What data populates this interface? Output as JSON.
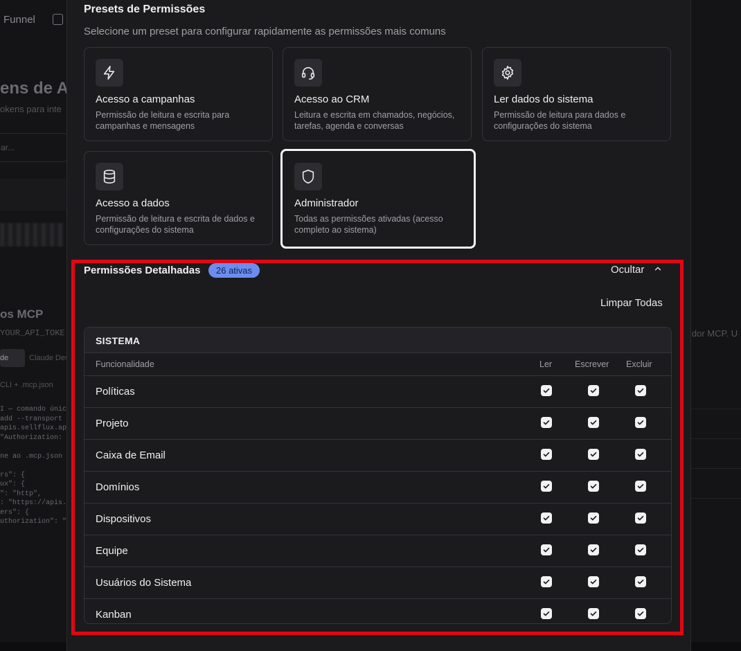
{
  "background": {
    "nav_funnel": "Funnel",
    "page_title": "ens de A",
    "page_subtitle": "okens para inte",
    "search_placeholder": "ar...",
    "mcp_title": "os MCP",
    "token_text": "YOUR_API_TOKE",
    "tab_active": "de",
    "tab_other": "Claude Des",
    "cli_label": "CLI + .mcp.json",
    "code_lines": "I — comando únic\nadd --transport\napis.sellflux.app\n\"Authorization: \n\nne ao .mcp.json \n\nrs\": {\nux\": {\n\": \"http\",\n: \"https://apis.\ners\": {\nuthorization\": \"B",
    "right_text": "idor MCP. U"
  },
  "presets": {
    "title": "Presets de Permissões",
    "subtitle": "Selecione um preset para configurar rapidamente as permissões mais comuns",
    "items": [
      {
        "icon": "lightning-icon",
        "title": "Acesso a campanhas",
        "desc": "Permissão de leitura e escrita para campanhas e mensagens"
      },
      {
        "icon": "headset-icon",
        "title": "Acesso ao CRM",
        "desc": "Leitura e escrita em chamados, negócios, tarefas, agenda e conversas"
      },
      {
        "icon": "gear-icon",
        "title": "Ler dados do sistema",
        "desc": "Permissão de leitura para dados e configurações do sistema"
      },
      {
        "icon": "database-icon",
        "title": "Acesso a dados",
        "desc": "Permissão de leitura e escrita de dados e configurações do sistema"
      },
      {
        "icon": "shield-icon",
        "title": "Administrador",
        "desc": "Todas as permissões ativadas (acesso completo ao sistema)",
        "selected": true
      }
    ]
  },
  "detailed": {
    "title": "Permissões Detalhadas",
    "badge": "26 ativas",
    "hide_label": "Ocultar",
    "clear_label": "Limpar Todas",
    "category": "SISTEMA",
    "columns": {
      "feature": "Funcionalidade",
      "read": "Ler",
      "write": "Escrever",
      "delete": "Excluir"
    },
    "rows": [
      {
        "label": "Políticas",
        "read": true,
        "write": true,
        "delete": true
      },
      {
        "label": "Projeto",
        "read": true,
        "write": true,
        "delete": true
      },
      {
        "label": "Caixa de Email",
        "read": true,
        "write": true,
        "delete": true
      },
      {
        "label": "Domínios",
        "read": true,
        "write": true,
        "delete": true
      },
      {
        "label": "Dispositivos",
        "read": true,
        "write": true,
        "delete": true
      },
      {
        "label": "Equipe",
        "read": true,
        "write": true,
        "delete": true
      },
      {
        "label": "Usuários do Sistema",
        "read": true,
        "write": true,
        "delete": true
      },
      {
        "label": "Kanban",
        "read": true,
        "write": true,
        "delete": true
      }
    ]
  },
  "colors": {
    "highlight": "#e30613",
    "badge": "#6b8df0",
    "modal_bg": "#1b1b1e"
  }
}
